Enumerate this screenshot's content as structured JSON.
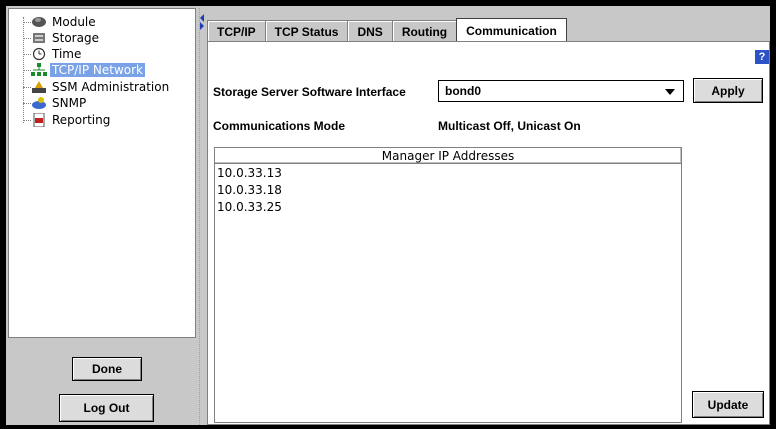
{
  "tree": {
    "items": [
      {
        "label": "Module",
        "icon": "module-icon"
      },
      {
        "label": "Storage",
        "icon": "storage-icon"
      },
      {
        "label": "Time",
        "icon": "clock-icon"
      },
      {
        "label": "TCP/IP Network",
        "icon": "network-icon",
        "selected": true
      },
      {
        "label": "SSM Administration",
        "icon": "admin-icon"
      },
      {
        "label": "SNMP",
        "icon": "snmp-icon"
      },
      {
        "label": "Reporting",
        "icon": "report-icon"
      }
    ]
  },
  "left_buttons": {
    "done": "Done",
    "logout": "Log Out"
  },
  "tabs": [
    "TCP/IP",
    "TCP Status",
    "DNS",
    "Routing",
    "Communication"
  ],
  "active_tab": "Communication",
  "help": "?",
  "form": {
    "interface_label": "Storage Server Software Interface",
    "interface_value": "bond0",
    "apply_label": "Apply",
    "mode_label": "Communications Mode",
    "mode_value": "Multicast Off, Unicast On"
  },
  "table": {
    "header": "Manager IP Addresses",
    "rows": [
      "10.0.33.13",
      "10.0.33.18",
      "10.0.33.25"
    ]
  },
  "update_label": "Update",
  "colors": {
    "selection": "#7aa2e6",
    "help": "#2c52c8",
    "divider_arrows": "#1c3fb5"
  }
}
